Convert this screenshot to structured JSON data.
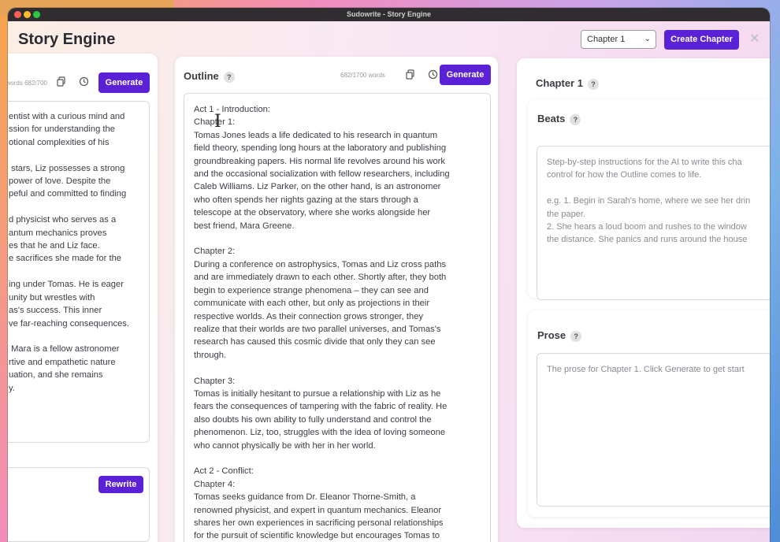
{
  "window": {
    "title": "Sudowrite - Story Engine"
  },
  "header": {
    "title": "Story Engine",
    "chapter_select": "Chapter 1",
    "create_button": "Create Chapter",
    "close": "✕"
  },
  "left_panel": {
    "word_count": "682/700 words",
    "generate_label": "Generate",
    "rewrite_label": "Rewrite",
    "text": "entist with a curious mind and\nssion for understanding the\notional complexities of his\n\n stars, Liz possesses a strong\npower of love. Despite the\npeful and committed to finding\n\nd physicist who serves as a\nantum mechanics proves\nes that he and Liz face.\ne sacrifices she made for the\n\ning under Tomas. He is eager\nunity but wrestles with\nas's success. This inner\nve far-reaching consequences.\n\n Mara is a fellow astronomer\nrtive and empathetic nature\nuation, and she remains\ny."
  },
  "outline_panel": {
    "title": "Outline",
    "word_count": "682/1700 words",
    "generate_label": "Generate",
    "text": "Act 1 - Introduction:\nChapter 1:\nTomas Jones leads a life dedicated to his research in quantum\nfield theory, spending long hours at the laboratory and publishing\ngroundbreaking papers. His normal life revolves around his work\nand the occasional socialization with fellow researchers, including\nCaleb Williams. Liz Parker, on the other hand, is an astronomer\nwho often spends her nights gazing at the stars through a\ntelescope at the observatory, where she works alongside her\nbest friend, Mara Greene.\n\nChapter 2:\nDuring a conference on astrophysics, Tomas and Liz cross paths\nand are immediately drawn to each other. Shortly after, they both\nbegin to experience strange phenomena – they can see and\ncommunicate with each other, but only as projections in their\nrespective worlds. As their connection grows stronger, they\nrealize that their worlds are two parallel universes, and Tomas's\nresearch has caused this cosmic divide that only they can see\nthrough.\n\nChapter 3:\nTomas is initially hesitant to pursue a relationship with Liz as he\nfears the consequences of tampering with the fabric of reality. He\nalso doubts his own ability to fully understand and control the\nphenomenon. Liz, too, struggles with the idea of loving someone\nwho cannot physically be with her in her world.\n\nAct 2 - Conflict:\nChapter 4:\nTomas seeks guidance from Dr. Eleanor Thorne-Smith, a\nrenowned physicist, and expert in quantum mechanics. Eleanor\nshares her own experiences in sacrificing personal relationships\nfor the pursuit of scientific knowledge but encourages Tomas to"
  },
  "right_panel": {
    "chapter_title": "Chapter 1",
    "beats_label": "Beats",
    "beats_placeholder": "Step-by-step instructions for the AI to write this cha\ncontrol for how the Outline comes to life.\n\ne.g. 1. Begin in Sarah's home, where we see her drin\nthe paper.\n2. She hears a loud boom and rushes to the window\nthe distance. She panics and runs around the house",
    "prose_label": "Prose",
    "prose_placeholder": "The prose for Chapter 1. Click Generate to get start"
  },
  "qmark": "?",
  "icons": {
    "copy": "copy-icon",
    "history": "history-icon",
    "chevron": "chevron-down-icon"
  },
  "colors": {
    "accent": "#5b21d6"
  }
}
